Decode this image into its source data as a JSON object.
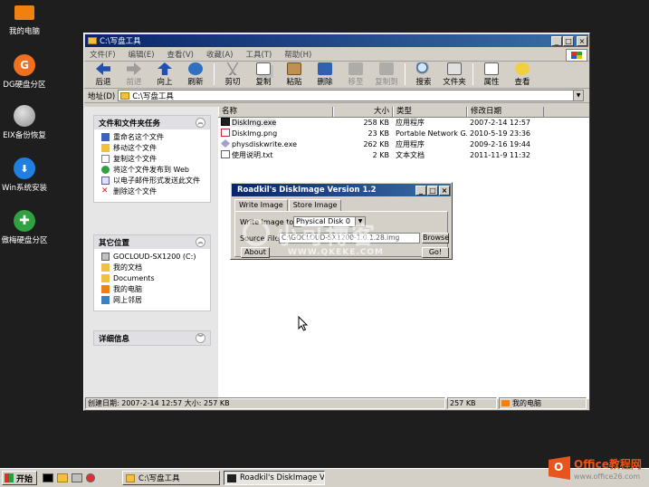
{
  "desktop": {
    "icons": [
      {
        "label": "我的电脑",
        "icon": "monitor-icon",
        "color": "#f08010"
      },
      {
        "label": "DG硬盘分区",
        "icon": "dg-disk-icon",
        "color": "#f07020",
        "glyph": "G"
      },
      {
        "label": "EIX备份恢复",
        "icon": "smiley-backup-icon",
        "color": "#b0b0b0"
      },
      {
        "label": "Win系统安装",
        "icon": "download-install-icon",
        "color": "#2080e0"
      },
      {
        "label": "傲梅硬盘分区",
        "icon": "aomei-partition-icon",
        "color": "#30a040"
      }
    ]
  },
  "explorer": {
    "title": "C:\\写盘工具",
    "menu": [
      "文件(F)",
      "编辑(E)",
      "查看(V)",
      "收藏(A)",
      "工具(T)",
      "帮助(H)"
    ],
    "toolbar": {
      "back": "后退",
      "forward": "前进",
      "up": "向上",
      "refresh": "刷新",
      "cut": "剪切",
      "copy": "复制",
      "paste": "粘贴",
      "delete": "删除",
      "move_to": "移至",
      "copy_to": "复制到",
      "search": "搜索",
      "folders": "文件夹",
      "properties": "属性",
      "views": "查看"
    },
    "address": {
      "label": "地址(D)",
      "value": "C:\\写盘工具"
    },
    "tasks_panel": {
      "title": "文件和文件夹任务",
      "items": [
        "重命名这个文件",
        "移动这个文件",
        "复制这个文件",
        "将这个文件发布到 Web",
        "以电子邮件形式发送此文件",
        "删除这个文件"
      ]
    },
    "places_panel": {
      "title": "其它位置",
      "items": [
        "GOCLOUD-SX1200 (C:)",
        "我的文档",
        "Documents",
        "我的电脑",
        "网上邻居"
      ]
    },
    "details_panel": {
      "title": "详细信息"
    },
    "columns": {
      "name": "名称",
      "size": "大小",
      "type": "类型",
      "modified": "修改日期"
    },
    "files": [
      {
        "name": "DiskImg.exe",
        "size": "258 KB",
        "type": "应用程序",
        "modified": "2007-2-14 12:57",
        "icon": "exe-icon"
      },
      {
        "name": "DiskImg.png",
        "size": "23 KB",
        "type": "Portable Network G...",
        "modified": "2010-5-19 23:36",
        "icon": "png-icon"
      },
      {
        "name": "physdiskwrite.exe",
        "size": "262 KB",
        "type": "应用程序",
        "modified": "2009-2-16 19:44",
        "icon": "exe-icon"
      },
      {
        "name": "使用说明.txt",
        "size": "2 KB",
        "type": "文本文档",
        "modified": "2011-11-9 11:32",
        "icon": "txt-icon"
      }
    ],
    "status": {
      "info": "创建日期: 2007-2-14 12:57 大小: 257 KB",
      "size": "257 KB",
      "location": "我的电脑"
    }
  },
  "dialog": {
    "title": "Roadkil's DiskImage Version 1.2",
    "tabs": [
      "Write Image",
      "Store Image"
    ],
    "write_image_label": "Write Image to",
    "disk_select": "Physical Disk 0",
    "source_label": "Source File",
    "source_value": "C:\\GOCLOUD-SX1200-1.0.1.28.img",
    "browse": "Browse",
    "about": "About",
    "go": "Go!"
  },
  "watermark": {
    "text": "小可博客",
    "url": "WWW.QKEKE.COM"
  },
  "taskbar": {
    "start": "开始",
    "items": [
      {
        "label": "C:\\写盘工具",
        "active": false
      },
      {
        "label": "Roadkil's DiskImage Versi...",
        "active": true
      }
    ]
  },
  "brand": {
    "name": "Office教程网",
    "url": "www.office26.com",
    "glyph": "O"
  }
}
